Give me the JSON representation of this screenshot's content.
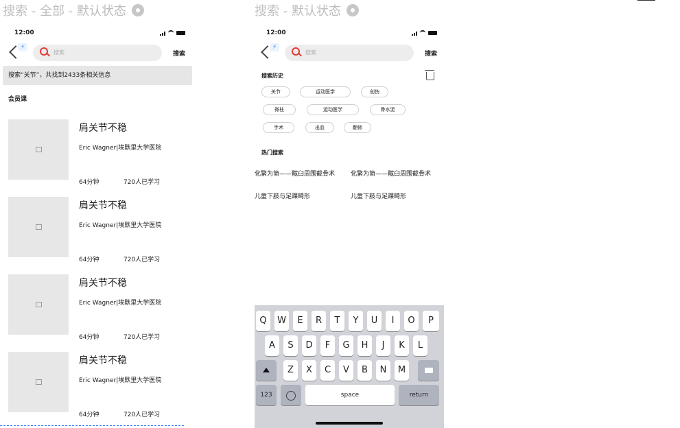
{
  "left": {
    "page_title": "搜索 - 全部 - 默认状态",
    "status_time": "12:00",
    "search_placeholder": "搜索",
    "search_button": "搜索",
    "result_summary": "搜索“关节”，共找到2433条相关信息",
    "section_title": "会员课",
    "courses": [
      {
        "title": "肩关节不稳",
        "author": "Eric Wagner|埃默里大学医院",
        "duration": "64分钟",
        "learners": "720人已学习"
      },
      {
        "title": "肩关节不稳",
        "author": "Eric Wagner|埃默里大学医院",
        "duration": "64分钟",
        "learners": "720人已学习"
      },
      {
        "title": "肩关节不稳",
        "author": "Eric Wagner|埃默里大学医院",
        "duration": "64分钟",
        "learners": "720人已学习"
      },
      {
        "title": "肩关节不稳",
        "author": "Eric Wagner|埃默里大学医院",
        "duration": "64分钟",
        "learners": "720人已学习"
      }
    ]
  },
  "right": {
    "page_title": "搜索 - 默认状态",
    "status_time": "12:00",
    "search_placeholder": "搜索",
    "search_button": "搜索",
    "history_title": "搜索历史",
    "history_chips": [
      "关节",
      "运动医学",
      "创伤",
      "脊柱",
      "运动医学",
      "骨水泥",
      "手术",
      "出血",
      "翻修"
    ],
    "hot_title": "热门搜索",
    "hot_items": [
      "化繁为简——髋臼周围截骨术",
      "化繁为简——髋臼周围截骨术",
      "儿童下肢与足踝畸形",
      "儿童下肢与足踝畸形"
    ],
    "keyboard": {
      "row1": [
        "Q",
        "W",
        "E",
        "R",
        "T",
        "Y",
        "U",
        "I",
        "O",
        "P"
      ],
      "row2": [
        "A",
        "S",
        "D",
        "F",
        "G",
        "H",
        "J",
        "K",
        "L"
      ],
      "row3": [
        "Z",
        "X",
        "C",
        "V",
        "B",
        "N",
        "M"
      ],
      "numbers_key": "123",
      "space_key": "space",
      "return_key": "return"
    }
  },
  "colors": {
    "accent": "#e53935",
    "link_blue": "#3b82f6",
    "keyboard_bg": "#d1d3d9"
  }
}
